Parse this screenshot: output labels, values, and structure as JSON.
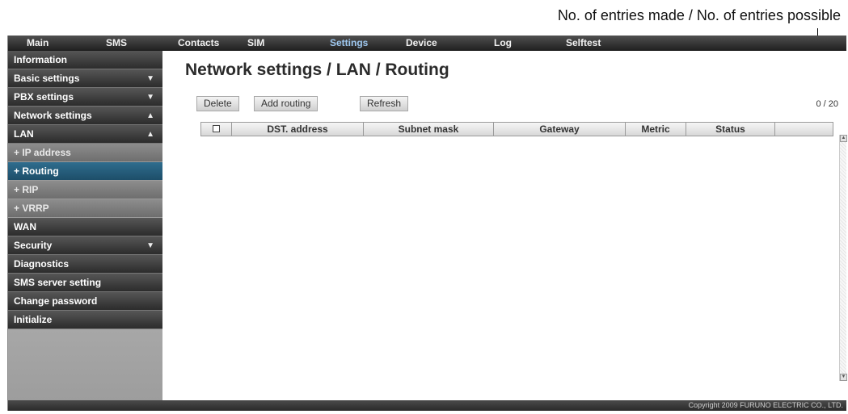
{
  "annotation": "No. of entries made / No. of entries possible",
  "nav": {
    "tabs": [
      {
        "label": "Main"
      },
      {
        "label": "SMS"
      },
      {
        "label": "Contacts"
      },
      {
        "label": "SIM"
      },
      {
        "label": "Settings",
        "active": true
      },
      {
        "label": "Device"
      },
      {
        "label": "Log"
      },
      {
        "label": "Selftest"
      }
    ]
  },
  "sidebar": {
    "items": [
      {
        "label": "Information"
      },
      {
        "label": "Basic settings",
        "arrow": "▼"
      },
      {
        "label": "PBX settings",
        "arrow": "▼"
      },
      {
        "label": "Network settings",
        "arrow": "▲"
      },
      {
        "label": "LAN",
        "arrow": "▲"
      },
      {
        "label": "+ IP address"
      },
      {
        "label": "+ Routing",
        "active": true
      },
      {
        "label": "+ RIP"
      },
      {
        "label": "+ VRRP"
      },
      {
        "label": "WAN"
      },
      {
        "label": "Security",
        "arrow": "▼"
      },
      {
        "label": "Diagnostics"
      },
      {
        "label": "SMS server setting"
      },
      {
        "label": "Change password"
      },
      {
        "label": "Initialize"
      }
    ]
  },
  "page": {
    "title": "Network settings / LAN / Routing",
    "buttons": {
      "delete": "Delete",
      "add_routing": "Add routing",
      "refresh": "Refresh"
    },
    "counter": "0 / 20",
    "table": {
      "columns": [
        "DST. address",
        "Subnet mask",
        "Gateway",
        "Metric",
        "Status"
      ]
    }
  },
  "footer": {
    "copyright": "Copyright 2009 FURUNO ELECTRIC CO., LTD."
  },
  "colors": {
    "active_tab": "#9ec8f0",
    "active_sidebar": "#2f6d8e"
  }
}
